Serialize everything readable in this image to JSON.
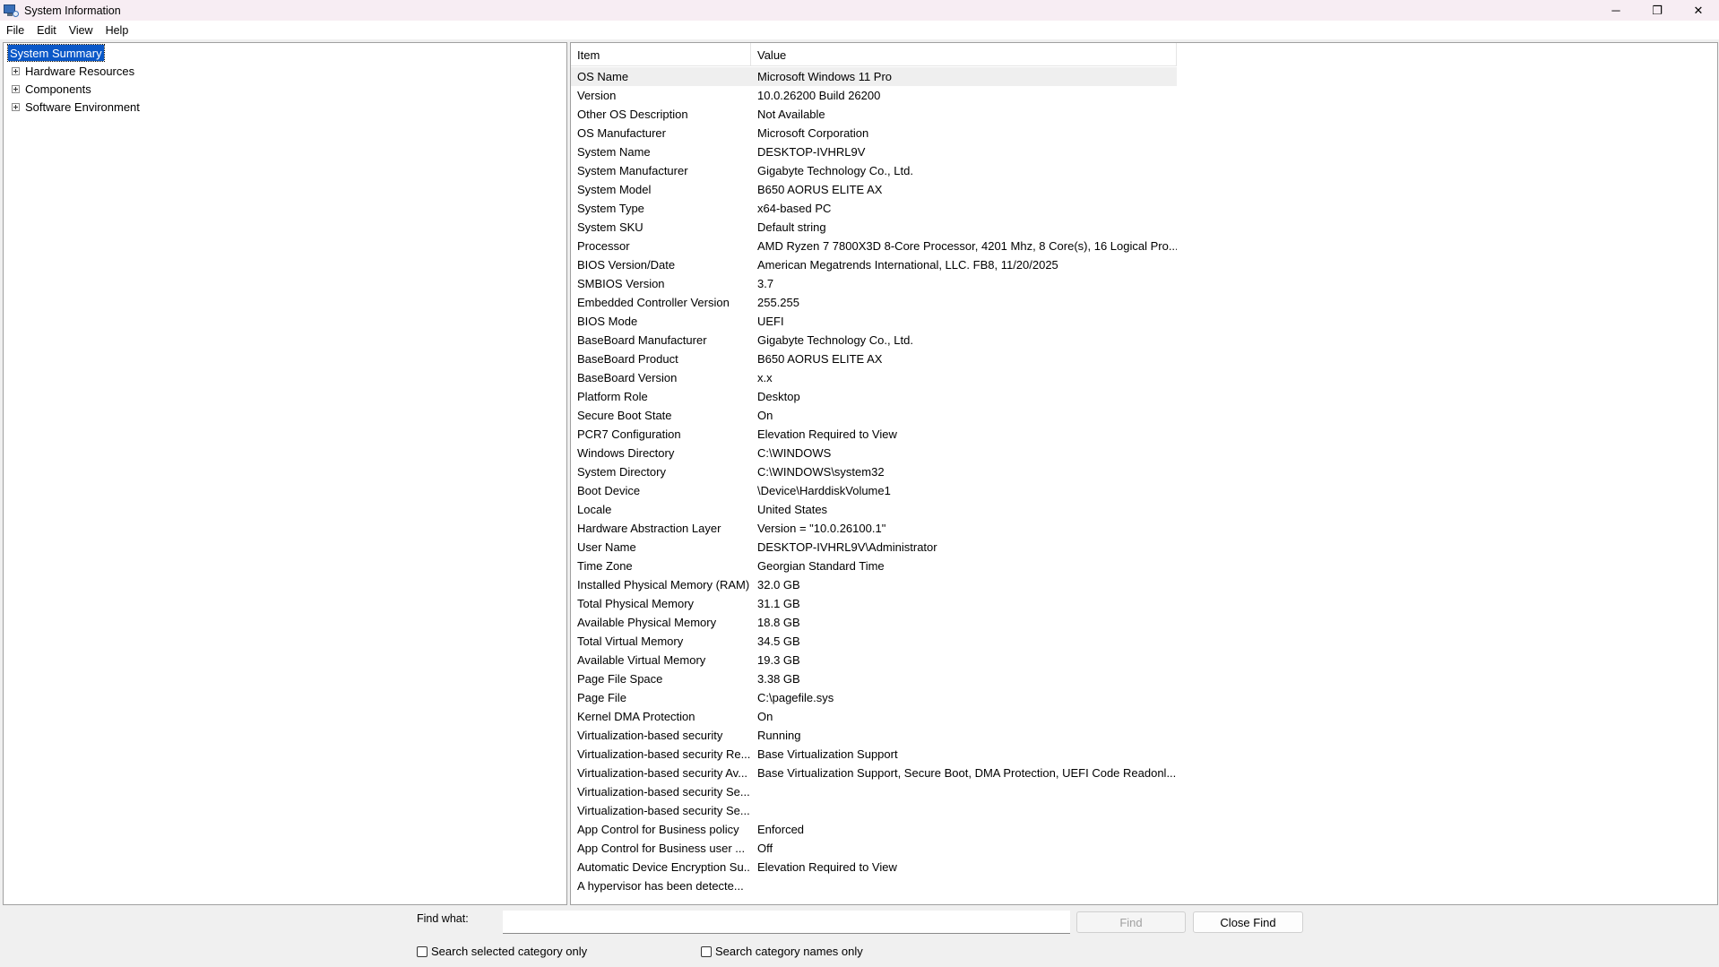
{
  "window": {
    "title": "System Information",
    "controls": {
      "minimize": "─",
      "restore": "❐",
      "close": "✕"
    }
  },
  "menu": [
    "File",
    "Edit",
    "View",
    "Help"
  ],
  "tree": {
    "selected": "System Summary",
    "children": [
      "Hardware Resources",
      "Components",
      "Software Environment"
    ]
  },
  "list": {
    "headers": {
      "item": "Item",
      "value": "Value"
    },
    "rows": [
      {
        "item": "OS Name",
        "value": "Microsoft Windows 11 Pro"
      },
      {
        "item": "Version",
        "value": "10.0.26200 Build 26200"
      },
      {
        "item": "Other OS Description",
        "value": "Not Available"
      },
      {
        "item": "OS Manufacturer",
        "value": "Microsoft Corporation"
      },
      {
        "item": "System Name",
        "value": "DESKTOP-IVHRL9V"
      },
      {
        "item": "System Manufacturer",
        "value": "Gigabyte Technology Co., Ltd."
      },
      {
        "item": "System Model",
        "value": "B650 AORUS ELITE AX"
      },
      {
        "item": "System Type",
        "value": "x64-based PC"
      },
      {
        "item": "System SKU",
        "value": "Default string"
      },
      {
        "item": "Processor",
        "value": "AMD Ryzen 7 7800X3D 8-Core Processor, 4201 Mhz, 8 Core(s), 16 Logical Pro..."
      },
      {
        "item": "BIOS Version/Date",
        "value": "American Megatrends International, LLC. FB8, 11/20/2025"
      },
      {
        "item": "SMBIOS Version",
        "value": "3.7"
      },
      {
        "item": "Embedded Controller Version",
        "value": "255.255"
      },
      {
        "item": "BIOS Mode",
        "value": "UEFI"
      },
      {
        "item": "BaseBoard Manufacturer",
        "value": "Gigabyte Technology Co., Ltd."
      },
      {
        "item": "BaseBoard Product",
        "value": "B650 AORUS ELITE AX"
      },
      {
        "item": "BaseBoard Version",
        "value": "x.x"
      },
      {
        "item": "Platform Role",
        "value": "Desktop"
      },
      {
        "item": "Secure Boot State",
        "value": "On"
      },
      {
        "item": "PCR7 Configuration",
        "value": "Elevation Required to View"
      },
      {
        "item": "Windows Directory",
        "value": "C:\\WINDOWS"
      },
      {
        "item": "System Directory",
        "value": "C:\\WINDOWS\\system32"
      },
      {
        "item": "Boot Device",
        "value": "\\Device\\HarddiskVolume1"
      },
      {
        "item": "Locale",
        "value": "United States"
      },
      {
        "item": "Hardware Abstraction Layer",
        "value": "Version = \"10.0.26100.1\""
      },
      {
        "item": "User Name",
        "value": "DESKTOP-IVHRL9V\\Administrator"
      },
      {
        "item": "Time Zone",
        "value": "Georgian Standard Time"
      },
      {
        "item": "Installed Physical Memory (RAM)",
        "value": "32.0 GB"
      },
      {
        "item": "Total Physical Memory",
        "value": "31.1 GB"
      },
      {
        "item": "Available Physical Memory",
        "value": "18.8 GB"
      },
      {
        "item": "Total Virtual Memory",
        "value": "34.5 GB"
      },
      {
        "item": "Available Virtual Memory",
        "value": "19.3 GB"
      },
      {
        "item": "Page File Space",
        "value": "3.38 GB"
      },
      {
        "item": "Page File",
        "value": "C:\\pagefile.sys"
      },
      {
        "item": "Kernel DMA Protection",
        "value": "On"
      },
      {
        "item": "Virtualization-based security",
        "value": "Running"
      },
      {
        "item": "Virtualization-based security Re...",
        "value": "Base Virtualization Support"
      },
      {
        "item": "Virtualization-based security Av...",
        "value": "Base Virtualization Support, Secure Boot, DMA Protection, UEFI Code Readonl..."
      },
      {
        "item": "Virtualization-based security Se...",
        "value": ""
      },
      {
        "item": "Virtualization-based security Se...",
        "value": ""
      },
      {
        "item": "App Control for Business policy",
        "value": "Enforced"
      },
      {
        "item": "App Control for Business user ...",
        "value": "Off"
      },
      {
        "item": "Automatic Device Encryption Su...",
        "value": "Elevation Required to View"
      },
      {
        "item": "A hypervisor has been detecte...",
        "value": ""
      }
    ]
  },
  "find": {
    "label": "Find what:",
    "value": "",
    "find_button": "Find",
    "close_button": "Close Find",
    "check_selected_category": "Search selected category only",
    "check_category_names": "Search category names only"
  },
  "colors": {
    "titlebar": "#f7edf3",
    "selection": "#0a58c8"
  }
}
